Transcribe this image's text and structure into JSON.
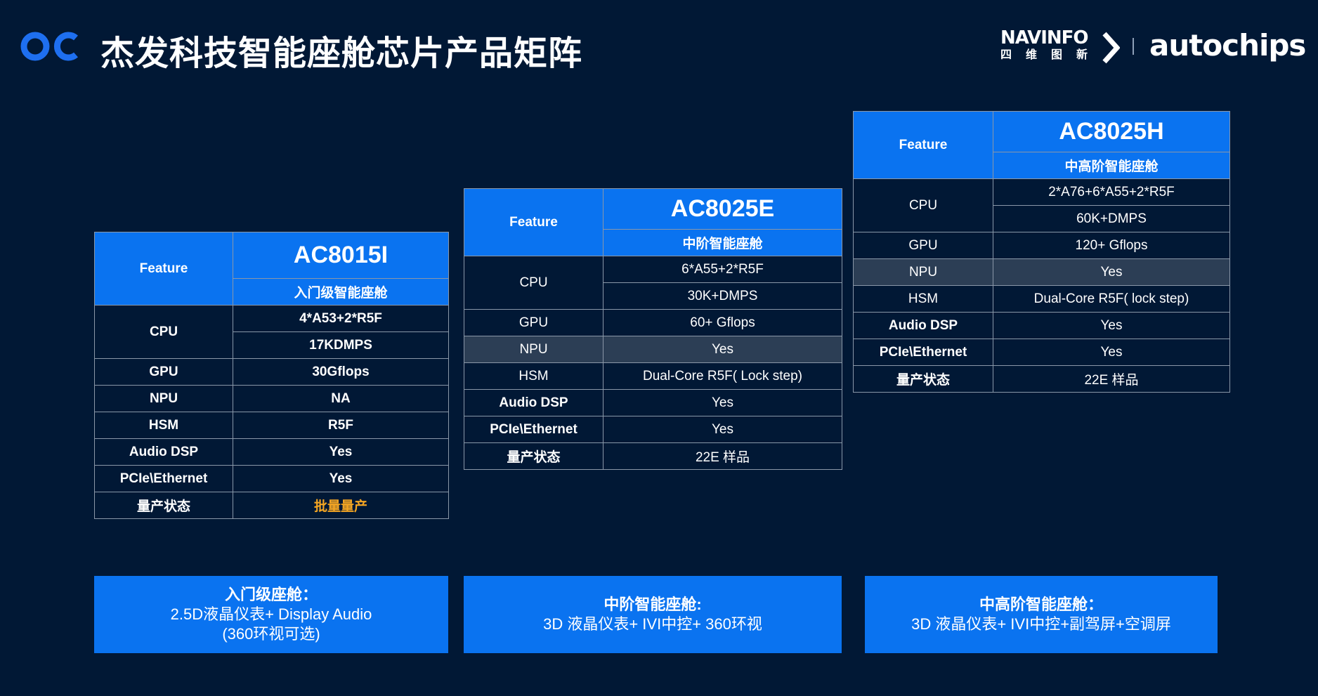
{
  "header": {
    "title": "杰发科技智能座舱芯片产品矩阵",
    "logo_icon": "oc-logo-icon",
    "brand_navinfo": "NAVINFO",
    "brand_navinfo_cn": "四维图新",
    "brand_autochips": "autochips",
    "accent": "#1e6ff0"
  },
  "colors": {
    "background": "#011835",
    "header_blue": "#0a73f0",
    "highlight_row": "#2c3e55",
    "orange_text": "#f5a623"
  },
  "tables": [
    {
      "feature_label": "Feature",
      "model": "AC8015I",
      "tier": "入门级智能座舱",
      "rows": {
        "cpu_label": "CPU",
        "cpu_1": "4*A53+2*R5F",
        "cpu_2": "17KDMPS",
        "gpu_label": "GPU",
        "gpu": "30Gflops",
        "npu_label": "NPU",
        "npu": "NA",
        "hsm_label": "HSM",
        "hsm": "R5F",
        "dsp_label": "Audio DSP",
        "dsp": "Yes",
        "pcie_label": "PCIe\\Ethernet",
        "pcie": "Yes",
        "status_label": "量产状态",
        "status": "批量量产"
      }
    },
    {
      "feature_label": "Feature",
      "model": "AC8025E",
      "tier": "中阶智能座舱",
      "rows": {
        "cpu_label": "CPU",
        "cpu_1": "6*A55+2*R5F",
        "cpu_2": "30K+DMPS",
        "gpu_label": "GPU",
        "gpu": "60+ Gflops",
        "npu_label": "NPU",
        "npu": "Yes",
        "hsm_label": "HSM",
        "hsm": "Dual-Core R5F( Lock step)",
        "dsp_label": "Audio DSP",
        "dsp": "Yes",
        "pcie_label": "PCIe\\Ethernet",
        "pcie": "Yes",
        "status_label": "量产状态",
        "status": "22E  样品"
      }
    },
    {
      "feature_label": "Feature",
      "model": "AC8025H",
      "tier": "中高阶智能座舱",
      "rows": {
        "cpu_label": "CPU",
        "cpu_1": "2*A76+6*A55+2*R5F",
        "cpu_2": "60K+DMPS",
        "gpu_label": "GPU",
        "gpu": "120+ Gflops",
        "npu_label": "NPU",
        "npu": "Yes",
        "hsm_label": "HSM",
        "hsm": "Dual-Core R5F( lock step)",
        "dsp_label": "Audio DSP",
        "dsp": "Yes",
        "pcie_label": "PCIe\\Ethernet",
        "pcie": "Yes",
        "status_label": "量产状态",
        "status": "22E  样品"
      }
    }
  ],
  "scenarios": [
    {
      "title": "入门级座舱：",
      "line1": "2.5D液晶仪表+ Display Audio",
      "line2": "(360环视可选)"
    },
    {
      "title": "中阶智能座舱:",
      "line1": "3D 液晶仪表+ IVI中控+ 360环视"
    },
    {
      "title": "中高阶智能座舱：",
      "line1": "3D 液晶仪表+ IVI中控+副驾屏+空调屏"
    }
  ]
}
